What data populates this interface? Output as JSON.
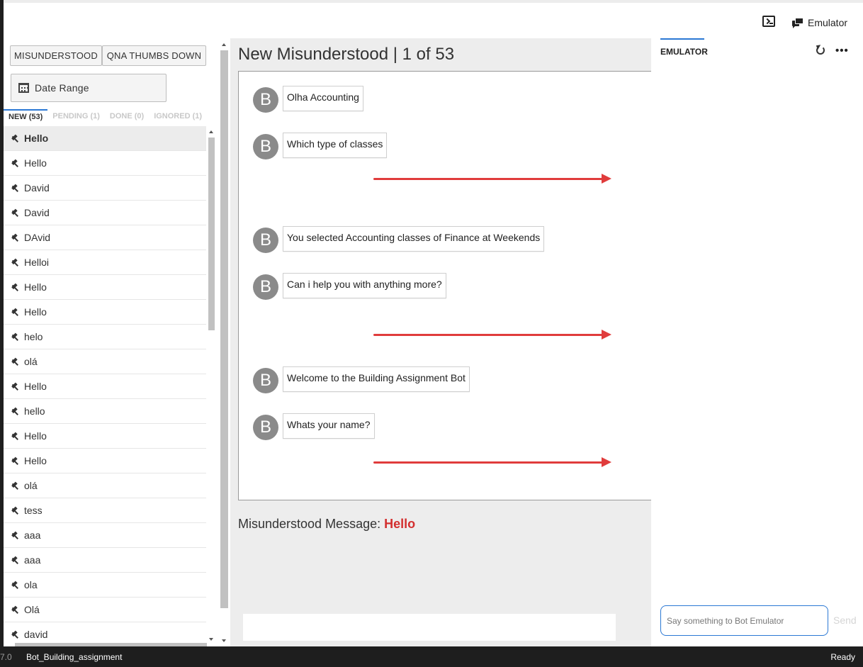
{
  "header": {
    "emulator_label": "Emulator"
  },
  "filters": {
    "misunderstood_label": "MISUNDERSTOOD",
    "qna_label": "QNA THUMBS DOWN",
    "date_range_label": "Date Range"
  },
  "tabs": [
    {
      "label": "NEW (53)",
      "active": true
    },
    {
      "label": "PENDING (1)",
      "active": false
    },
    {
      "label": "DONE (0)",
      "active": false
    },
    {
      "label": "IGNORED (1)",
      "active": false
    }
  ],
  "list_items": [
    "Hello",
    "Hello",
    "David",
    "David",
    "DAvid",
    "Helloi",
    "Hello",
    "Hello",
    "helo",
    "olá",
    "Hello",
    "hello",
    "Hello",
    "Hello",
    "olá",
    "tess",
    "aaa",
    "aaa",
    "ola",
    "Olá",
    "david"
  ],
  "center": {
    "title": "New Misunderstood | 1 of 53",
    "messages": [
      {
        "avatar": "B",
        "text": "Olha Accounting"
      },
      {
        "avatar": "B",
        "text": "Which type of classes"
      },
      {
        "avatar": "B",
        "text": "You selected Accounting classes of Finance at Weekends"
      },
      {
        "avatar": "B",
        "text": "Can i help you with anything more?"
      },
      {
        "avatar": "B",
        "text": "Welcome to the Building Assignment Bot"
      },
      {
        "avatar": "B",
        "text": "Whats your name?"
      }
    ],
    "misunderstood_label": "Misunderstood Message: ",
    "misunderstood_value": "Hello",
    "annotation_color": "#e03c3c"
  },
  "emulator": {
    "tab_label": "EMULATOR",
    "input_placeholder": "Say something to Bot Emulator",
    "send_label": "Send"
  },
  "status": {
    "version": "7.0",
    "bot_name": "Bot_Building_assignment",
    "state": "Ready"
  }
}
